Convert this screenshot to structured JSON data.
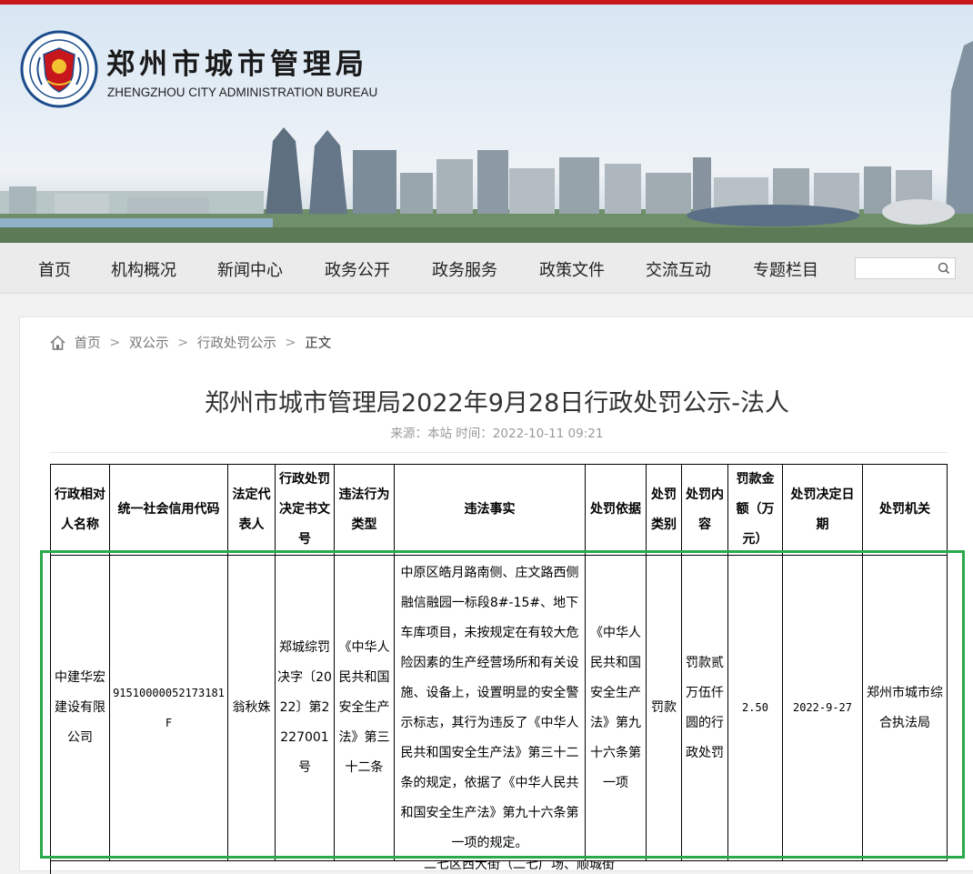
{
  "header": {
    "site_name": "郑州市城市管理局",
    "site_name_en": "ZHENGZHOU CITY ADMINISTRATION BUREAU",
    "emblem_icon": "shield-emblem-icon",
    "brand_color": "#c8161d"
  },
  "nav": {
    "items": [
      "首页",
      "机构概况",
      "新闻中心",
      "政务公开",
      "政务服务",
      "政策文件",
      "交流互动",
      "专题栏目"
    ],
    "search_placeholder": "",
    "search_icon": "search-icon"
  },
  "breadcrumb": {
    "home_icon": "home-icon",
    "items": [
      "首页",
      "双公示",
      "行政处罚公示"
    ],
    "current": "正文",
    "separator": ">"
  },
  "article": {
    "title": "郑州市城市管理局2022年9月28日行政处罚公示-法人",
    "meta": "来源：本站  时间：2022-10-11 09:21"
  },
  "table": {
    "headers": [
      "行政相对人名称",
      "统一社会信用代码",
      "法定代表人",
      "行政处罚决定书文号",
      "违法行为类型",
      "违法事实",
      "处罚依据",
      "处罚类别",
      "处罚内容",
      "罚款金额（万元）",
      "处罚决定日期",
      "处罚机关"
    ],
    "rows": [
      {
        "name": "中建华宏建设有限公司",
        "credit_code": "91510000052173181F",
        "legal_rep": "翁秋姝",
        "doc_no": "郑城综罚决字〔2022〕第2227001号",
        "violation_type": "《中华人民共和国安全生产法》第三十二条",
        "facts": "中原区皓月路南侧、庄文路西侧融信融园一标段8#-15#、地下车库项目，未按规定在有较大危险因素的生产经营场所和有关设施、设备上，设置明显的安全警示标志，其行为违反了《中华人民共和国安全生产法》第三十二条的规定，依据了《中华人民共和国安全生产法》第九十六条第一项的规定。",
        "basis": "《中华人民共和国安全生产法》第九十六条第一项",
        "category": "罚款",
        "content": "罚款贰万伍仟圆的行政处罚",
        "amount": "2.50",
        "date": "2022-9-27",
        "authority": "郑州市城市综合执法局"
      }
    ],
    "next_row_partial": "二七区西大街（二七广场、顺城街"
  },
  "highlight_color": "#2aa84a"
}
